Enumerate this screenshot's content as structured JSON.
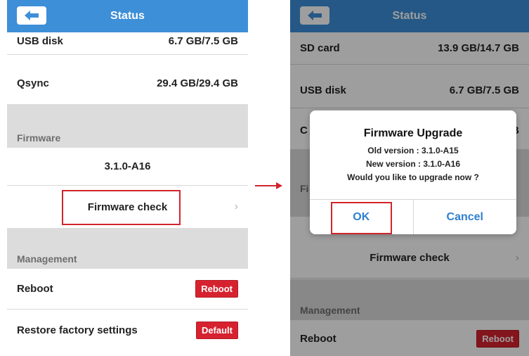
{
  "left_screen": {
    "header": {
      "title": "Status",
      "back_icon": "arrow-left-icon"
    },
    "rows": {
      "usb_disk": {
        "label": "USB disk",
        "value": "6.7 GB/7.5 GB"
      },
      "qsync": {
        "label": "Qsync",
        "value": "29.4 GB/29.4 GB"
      }
    },
    "firmware": {
      "section_label": "Firmware",
      "version": "3.1.0-A16",
      "check_label": "Firmware check"
    },
    "management": {
      "section_label": "Management",
      "reboot": {
        "label": "Reboot",
        "button": "Reboot"
      },
      "restore": {
        "label": "Restore factory settings",
        "button": "Default"
      }
    }
  },
  "right_screen": {
    "header": {
      "title": "Status",
      "back_icon": "arrow-left-icon"
    },
    "rows": {
      "sd_card": {
        "label": "SD card",
        "value": "13.9 GB/14.7 GB"
      },
      "usb_disk": {
        "label": "USB disk",
        "value": "6.7 GB/7.5 GB"
      },
      "partial_label_c": "C",
      "partial_value_b": "B",
      "partial_label_fi": "Fi"
    },
    "firmware_check_label": "Firmware check",
    "management": {
      "section_label": "Management",
      "reboot": {
        "label": "Reboot",
        "button": "Reboot"
      }
    },
    "dialog": {
      "title": "Firmware Upgrade",
      "old_version": "Old version : 3.1.0-A15",
      "new_version": "New version : 3.1.0-A16",
      "question": "Would you like to upgrade now ?",
      "ok": "OK",
      "cancel": "Cancel"
    }
  },
  "colors": {
    "header_blue": "#3d8fd8",
    "reboot_red": "#d6222f",
    "highlight_red": "#d0252c",
    "dialog_button_blue": "#2f7fd0"
  }
}
